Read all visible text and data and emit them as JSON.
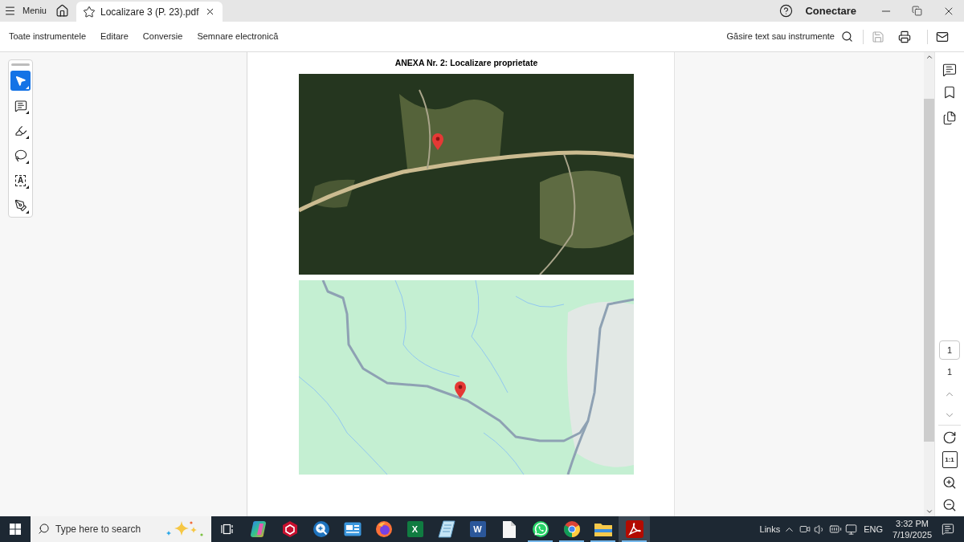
{
  "title_bar": {
    "menu_label": "Meniu",
    "tabs": [
      {
        "title": "Localizare 3 (P. 23).pdf",
        "selected": true
      }
    ],
    "sign_in_label": "Conectare"
  },
  "toolbar": {
    "menu_items": [
      "Toate instrumentele",
      "Editare",
      "Conversie",
      "Semnare electronică"
    ],
    "find_label": "Găsire text sau instrumente",
    "actions": [
      {
        "kind": "save",
        "disabled": true
      },
      {
        "kind": "print",
        "disabled": false
      },
      {
        "kind": "mail",
        "disabled": false
      }
    ]
  },
  "tool_panel": {
    "tools": [
      {
        "kind": "select",
        "selected": true
      },
      {
        "kind": "comment",
        "selected": false
      },
      {
        "kind": "highlight",
        "selected": false
      },
      {
        "kind": "draw",
        "selected": false
      },
      {
        "kind": "text",
        "label": "A",
        "selected": false
      },
      {
        "kind": "sign",
        "selected": false
      }
    ]
  },
  "document": {
    "heading": "ANEXA Nr. 2: Localizare proprietate",
    "figures": [
      {
        "kind": "satellite"
      },
      {
        "kind": "map"
      }
    ]
  },
  "right_panel": {
    "current_page": "1",
    "page_count": "1",
    "fit_label": "1:1"
  },
  "taskbar": {
    "placeholder": "Type here to search",
    "apps": [
      {
        "kind": "copilot",
        "running": false,
        "selected": false
      },
      {
        "kind": "hexagon",
        "running": false,
        "selected": false
      },
      {
        "kind": "magnifier",
        "running": false,
        "selected": false
      },
      {
        "kind": "display",
        "running": false,
        "selected": false
      },
      {
        "kind": "firefox",
        "running": false,
        "selected": false
      },
      {
        "kind": "excel",
        "letter": "X",
        "running": false,
        "selected": false
      },
      {
        "kind": "notepad",
        "running": false,
        "selected": false
      },
      {
        "kind": "word",
        "letter": "W",
        "running": false,
        "selected": false
      },
      {
        "kind": "file",
        "running": false,
        "selected": false
      },
      {
        "kind": "whatsapp",
        "running": true,
        "selected": false
      },
      {
        "kind": "chrome",
        "running": true,
        "selected": false
      },
      {
        "kind": "explorer",
        "running": true,
        "selected": false
      },
      {
        "kind": "acrobat",
        "running": true,
        "selected": true
      }
    ],
    "tray": {
      "links_label": "Links",
      "language": "ENG",
      "time": "3:32 PM",
      "date": "7/19/2025"
    }
  }
}
